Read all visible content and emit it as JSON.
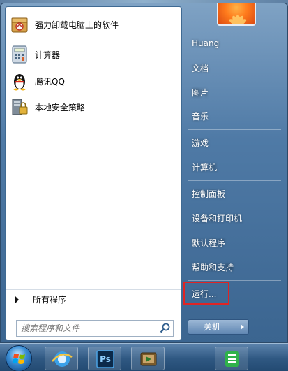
{
  "programs": [
    {
      "label": "强力卸载电脑上的软件",
      "icon": "uninstall-box-icon"
    },
    {
      "label": "计算器",
      "icon": "calculator-icon"
    },
    {
      "label": "腾讯QQ",
      "icon": "qq-penguin-icon"
    },
    {
      "label": "本地安全策略",
      "icon": "security-policy-icon"
    }
  ],
  "all_programs_label": "所有程序",
  "search": {
    "placeholder": "搜索程序和文件",
    "icon": "search-icon"
  },
  "right_items": [
    {
      "label": "Huang"
    },
    {
      "label": "文档"
    },
    {
      "label": "图片"
    },
    {
      "label": "音乐"
    },
    {
      "label": "游戏"
    },
    {
      "label": "计算机"
    },
    {
      "label": "控制面板"
    },
    {
      "label": "设备和打印机"
    },
    {
      "label": "默认程序"
    },
    {
      "label": "帮助和支持"
    },
    {
      "label": "运行..."
    }
  ],
  "shutdown_label": "关机",
  "highlight_color": "#e02424",
  "taskbar": {
    "start_icon": "windows-orb-icon",
    "pinned": [
      "ie-icon",
      "photoshop-icon",
      "movie-maker-icon",
      "green-app-icon"
    ],
    "photoshop_text": "Ps"
  }
}
